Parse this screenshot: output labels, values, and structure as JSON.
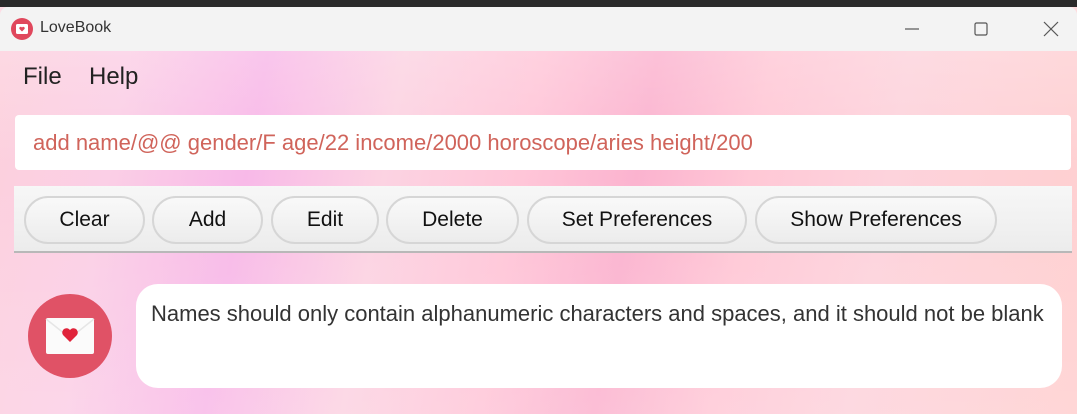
{
  "window": {
    "title": "LoveBook",
    "app_icon": "lovebook-app-icon",
    "controls": [
      "minimize-icon",
      "maximize-icon",
      "close-icon"
    ]
  },
  "menu": {
    "file": "File",
    "help": "Help"
  },
  "command": {
    "value": "add name/@@ gender/F age/22 income/2000 horoscope/aries height/200"
  },
  "toolbar": {
    "clear": "Clear",
    "add": "Add",
    "edit": "Edit",
    "delete": "Delete",
    "set_preferences": "Set Preferences",
    "show_preferences": "Show Preferences"
  },
  "result": {
    "avatar_icon": "envelope-heart-icon",
    "message": "Names should only contain alphanumeric characters and spaces, and it should not be blank"
  },
  "colors": {
    "accent": "#e05266",
    "command_text": "#d0645b"
  }
}
